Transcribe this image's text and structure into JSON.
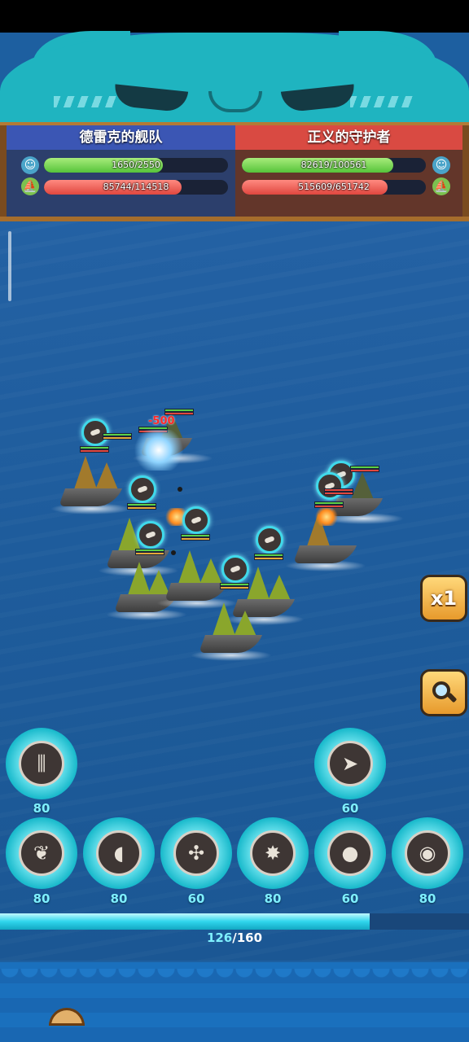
{
  "teams": {
    "left": {
      "name": "德雷克的舰队",
      "crew_hp": {
        "text": "1650/2550",
        "fraction": 0.647
      },
      "ship_hp": {
        "text": "85744/114518",
        "fraction": 0.749
      }
    },
    "right": {
      "name": "正义的守护者",
      "crew_hp": {
        "text": "82619/100561",
        "fraction": 0.822
      },
      "ship_hp": {
        "text": "515609/651742",
        "fraction": 0.791
      }
    }
  },
  "battle": {
    "damage_popup": "-500"
  },
  "controls": {
    "speed_label": "x1",
    "zoom_icon": "magnifier-icon"
  },
  "skills_top": [
    {
      "icon": "torpedo-volley-icon",
      "cost": "80"
    },
    {
      "icon": "shark-icon",
      "cost": "60"
    }
  ],
  "skills_bottom": [
    {
      "icon": "winged-emblem-icon",
      "cost": "80"
    },
    {
      "icon": "horn-icon",
      "cost": "80"
    },
    {
      "icon": "helm-wheel-icon",
      "cost": "60"
    },
    {
      "icon": "strike-icon",
      "cost": "80"
    },
    {
      "icon": "cannonball-icon",
      "cost": "60"
    },
    {
      "icon": "bomb-icon",
      "cost": "80"
    }
  ],
  "energy": {
    "current": "126",
    "max": "/160",
    "fraction": 0.7875
  },
  "colors": {
    "accent_cyan": "#2fd6ec",
    "team_blue": "#3b56b4",
    "team_red": "#d94a42",
    "sea": "#1e5c9c"
  }
}
